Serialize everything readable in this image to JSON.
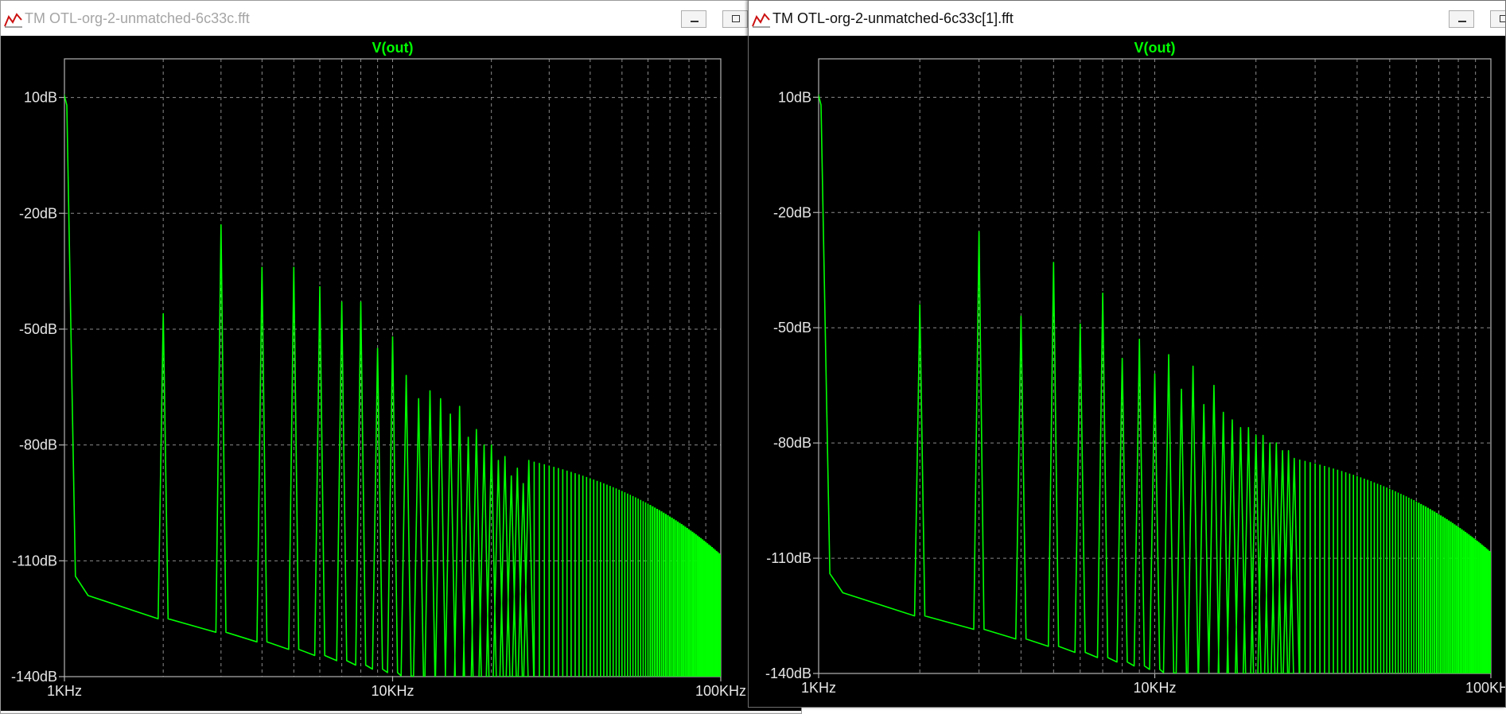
{
  "windows": [
    {
      "title": "TM OTL-org-2-unmatched-6c33c.fft",
      "active": false,
      "icon": "waveform-icon",
      "chart_data": {
        "type": "line",
        "title": "V(out)",
        "xscale": "log",
        "xlim": [
          1000,
          100000
        ],
        "ylim": [
          -140,
          20
        ],
        "xticks": [
          "1KHz",
          "10KHz",
          "100KHz"
        ],
        "yticks": [
          "10dB",
          "-20dB",
          "-50dB",
          "-80dB",
          "-110dB",
          "-140dB"
        ],
        "grid": true,
        "series": [
          {
            "color": "#00ff00"
          }
        ],
        "fundamental": {
          "x": 1000,
          "y": 12
        },
        "floor": {
          "start": -119,
          "end": -140
        },
        "harmonics": [
          [
            2,
            -46
          ],
          [
            3,
            -23
          ],
          [
            4,
            -34
          ],
          [
            5,
            -34
          ],
          [
            6,
            -39
          ],
          [
            7,
            -43
          ],
          [
            8,
            -43
          ],
          [
            9,
            -55
          ],
          [
            10,
            -52
          ],
          [
            11,
            -62
          ],
          [
            12,
            -68
          ],
          [
            13,
            -66
          ],
          [
            14,
            -68
          ],
          [
            15,
            -72
          ],
          [
            16,
            -70
          ],
          [
            17,
            -78
          ],
          [
            18,
            -76
          ],
          [
            19,
            -80
          ],
          [
            20,
            -80
          ],
          [
            21,
            -84
          ],
          [
            22,
            -83
          ],
          [
            23,
            -88
          ],
          [
            24,
            -86
          ],
          [
            25,
            -90
          ],
          [
            26,
            -84
          ]
        ]
      }
    },
    {
      "title": "TM OTL-org-2-unmatched-6c33c[1].fft",
      "active": true,
      "icon": "waveform-icon",
      "chart_data": {
        "type": "line",
        "title": "V(out)",
        "xscale": "log",
        "xlim": [
          1000,
          100000
        ],
        "ylim": [
          -140,
          20
        ],
        "xticks": [
          "1KHz",
          "10KHz",
          "100KHz"
        ],
        "yticks": [
          "10dB",
          "-20dB",
          "-50dB",
          "-80dB",
          "-110dB",
          "-140dB"
        ],
        "grid": true,
        "series": [
          {
            "color": "#00ff00"
          }
        ],
        "fundamental": {
          "x": 1000,
          "y": 12
        },
        "floor": {
          "start": -119,
          "end": -140
        },
        "harmonics": [
          [
            2,
            -44
          ],
          [
            3,
            -25
          ],
          [
            4,
            -47
          ],
          [
            5,
            -33
          ],
          [
            6,
            -49
          ],
          [
            7,
            -41
          ],
          [
            8,
            -58
          ],
          [
            9,
            -53
          ],
          [
            10,
            -62
          ],
          [
            11,
            -57
          ],
          [
            12,
            -66
          ],
          [
            13,
            -60
          ],
          [
            14,
            -70
          ],
          [
            15,
            -65
          ],
          [
            16,
            -72
          ],
          [
            17,
            -74
          ],
          [
            18,
            -76
          ],
          [
            19,
            -76
          ],
          [
            20,
            -78
          ],
          [
            21,
            -78
          ],
          [
            22,
            -80
          ],
          [
            23,
            -80
          ],
          [
            24,
            -82
          ],
          [
            25,
            -82
          ],
          [
            26,
            -84
          ]
        ]
      }
    }
  ]
}
